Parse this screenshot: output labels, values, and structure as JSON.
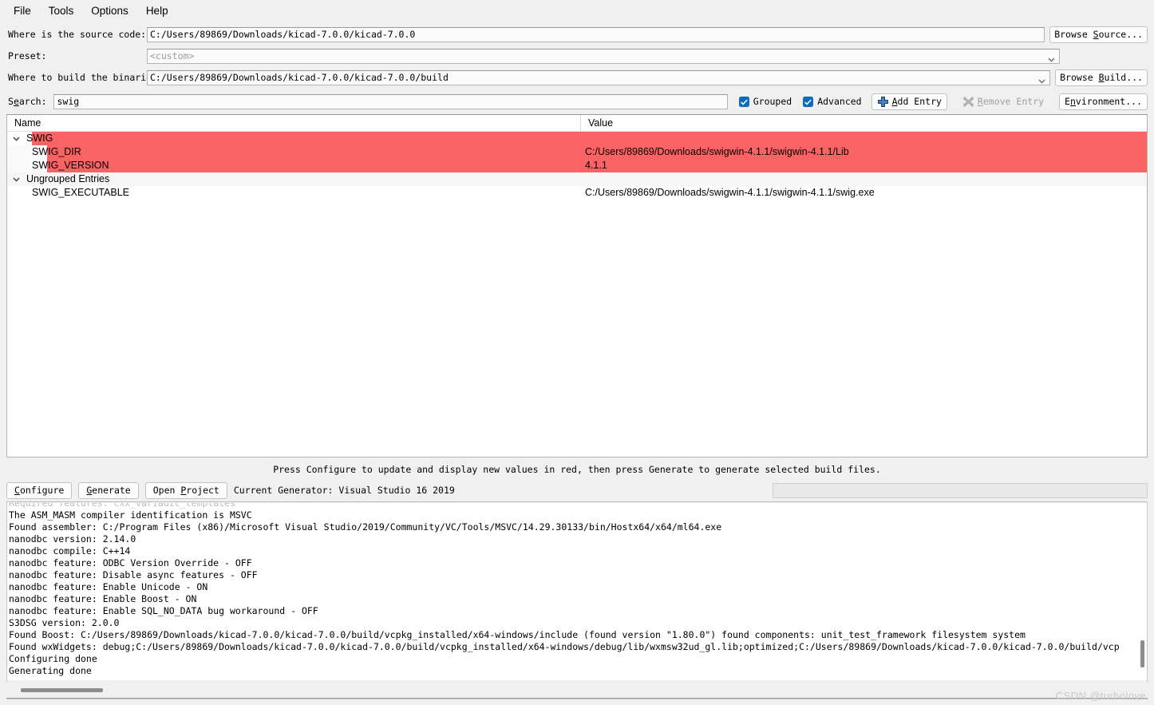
{
  "menubar": {
    "items": [
      {
        "label": "File"
      },
      {
        "label": "Tools"
      },
      {
        "label": "Options"
      },
      {
        "label": "Help"
      }
    ]
  },
  "form": {
    "source_label": "Where is the source code:",
    "source_value": "C:/Users/89869/Downloads/kicad-7.0.0/kicad-7.0.0",
    "browse_source_label_pre": "Browse ",
    "browse_source_label_mnemonic": "S",
    "browse_source_label_post": "ource...",
    "preset_label": "Preset:",
    "preset_value": "<custom>",
    "build_label": "Where to build the binaries:",
    "build_value": "C:/Users/89869/Downloads/kicad-7.0.0/kicad-7.0.0/build",
    "browse_build_label_pre": "Browse ",
    "browse_build_label_mnemonic": "B",
    "browse_build_label_post": "uild..."
  },
  "search": {
    "label_pre": "S",
    "label_mnemonic": "e",
    "label_post": "arch:",
    "value": "swig",
    "placeholder": ""
  },
  "toolbar": {
    "grouped_label": "Grouped",
    "grouped_checked": true,
    "advanced_label": "Advanced",
    "advanced_checked": true,
    "add_entry_pre": "",
    "add_entry_mnemonic": "A",
    "add_entry_post": "dd Entry",
    "add_entry_icon": "plus-icon",
    "remove_entry_pre": "",
    "remove_entry_mnemonic": "R",
    "remove_entry_post": "emove Entry",
    "remove_entry_icon": "x-icon",
    "remove_entry_disabled": true,
    "environment_pre": "E",
    "environment_mnemonic": "n",
    "environment_post": "vironment..."
  },
  "table": {
    "columns": [
      "Name",
      "Value"
    ],
    "rows": [
      {
        "name": "SWIG",
        "value": "",
        "kind": "group",
        "expanded": true,
        "highlight": "red"
      },
      {
        "name": "SWIG_DIR",
        "value": "C:/Users/89869/Downloads/swigwin-4.1.1/swigwin-4.1.1/Lib",
        "kind": "child",
        "highlight": "red"
      },
      {
        "name": "SWIG_VERSION",
        "value": "4.1.1",
        "kind": "child",
        "highlight": "red"
      },
      {
        "name": "Ungrouped Entries",
        "value": "",
        "kind": "group",
        "expanded": true,
        "highlight": "band"
      },
      {
        "name": "SWIG_EXECUTABLE",
        "value": "C:/Users/89869/Downloads/swigwin-4.1.1/swigwin-4.1.1/swig.exe",
        "kind": "child",
        "highlight": "none"
      }
    ]
  },
  "status": {
    "message": "Press Configure to update and display new values in red, then press Generate to generate selected build files."
  },
  "buttons": {
    "configure_pre": "",
    "configure_mnemonic": "C",
    "configure_post": "onfigure",
    "generate_pre": "",
    "generate_mnemonic": "G",
    "generate_post": "enerate",
    "open_project_pre": "Open ",
    "open_project_mnemonic": "P",
    "open_project_post": "roject",
    "current_generator": "Current Generator: Visual Studio 16 2019",
    "progress_value": 0
  },
  "log": {
    "clipped_top_line": "Required features: cxx_variadic_templates",
    "lines": [
      "The ASM_MASM compiler identification is MSVC",
      "Found assembler: C:/Program Files (x86)/Microsoft Visual Studio/2019/Community/VC/Tools/MSVC/14.29.30133/bin/Hostx64/x64/ml64.exe",
      "nanodbc version: 2.14.0",
      "nanodbc compile: C++14",
      "nanodbc feature: ODBC Version Override - OFF",
      "nanodbc feature: Disable async features - OFF",
      "nanodbc feature: Enable Unicode - ON",
      "nanodbc feature: Enable Boost - ON",
      "nanodbc feature: Enable SQL_NO_DATA bug workaround - OFF",
      "S3DSG version: 2.0.0",
      "Found Boost: C:/Users/89869/Downloads/kicad-7.0.0/kicad-7.0.0/build/vcpkg_installed/x64-windows/include (found version \"1.80.0\") found components: unit_test_framework filesystem system",
      "Found wxWidgets: debug;C:/Users/89869/Downloads/kicad-7.0.0/kicad-7.0.0/build/vcpkg_installed/x64-windows/debug/lib/wxmsw32ud_gl.lib;optimized;C:/Users/89869/Downloads/kicad-7.0.0/kicad-7.0.0/build/vcp",
      "Configuring done",
      "Generating done"
    ]
  },
  "watermark": {
    "text": "CSDN @turbolove"
  },
  "colors": {
    "highlight_red": "#fa6363",
    "checkbox_blue": "#0f6cbd",
    "window_bg": "#f0f0f0",
    "field_bg": "#fbfbfb"
  }
}
